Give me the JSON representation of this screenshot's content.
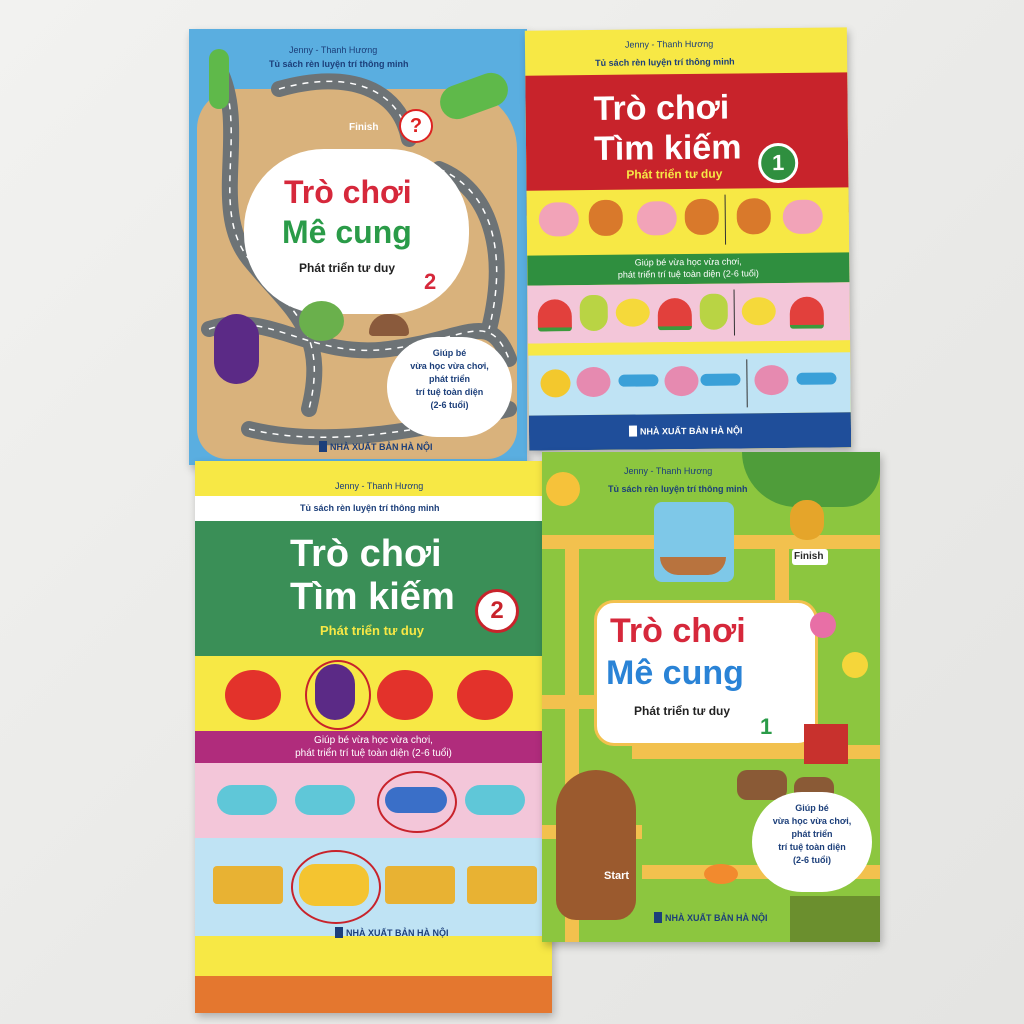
{
  "books": {
    "maze2": {
      "authors": "Jenny - Thanh Hương",
      "series": "Tủ sách rèn luyện trí thông minh",
      "finish": "Finish",
      "question": "?",
      "title_line1": "Trò chơi",
      "title_line2": "Mê cung",
      "subtitle": "Phát triển tư duy",
      "number": "2",
      "blurb": [
        "Giúp bé",
        "vừa học vừa chơi,",
        "phát triển",
        "trí tuệ toàn diện",
        "(2-6 tuổi)"
      ],
      "publisher": "NHÀ XUẤT BẢN HÀ NỘI"
    },
    "search1": {
      "authors": "Jenny - Thanh Hương",
      "series": "Tủ sách rèn luyện trí thông minh",
      "title_line1": "Trò chơi",
      "title_line2": "Tìm kiếm",
      "number": "1",
      "subtitle": "Phát triển tư duy",
      "blurb": [
        "Giúp bé vừa học vừa chơi,",
        "phát triển trí tuệ toàn diện (2-6 tuổi)"
      ],
      "publisher": "NHÀ XUẤT BẢN HÀ NỘI"
    },
    "search2": {
      "authors": "Jenny - Thanh Hương",
      "series": "Tủ sách rèn luyện trí thông minh",
      "title_line1": "Trò chơi",
      "title_line2": "Tìm kiếm",
      "number": "2",
      "subtitle": "Phát triển tư duy",
      "blurb": [
        "Giúp bé vừa học vừa chơi,",
        "phát triển trí tuệ toàn diện (2-6 tuổi)"
      ],
      "publisher": "NHÀ XUẤT BẢN HÀ NỘI"
    },
    "maze1": {
      "authors": "Jenny - Thanh Hương",
      "series": "Tủ sách rèn luyện trí thông minh",
      "finish": "Finish",
      "start": "Start",
      "title_line1": "Trò chơi",
      "title_line2": "Mê cung",
      "subtitle": "Phát triển tư duy",
      "number": "1",
      "blurb": [
        "Giúp bé",
        "vừa học vừa chơi,",
        "phát triển",
        "trí tuệ toàn diện",
        "(2-6 tuổi)"
      ],
      "publisher": "NHÀ XUẤT BẢN HÀ NỘI"
    }
  },
  "colors": {
    "maze_blue": "#5aaee0",
    "search1_red": "#c8232b",
    "search2_green": "#3a8f57",
    "yellow_band": "#f7e845",
    "pink_band": "#f3c6d9",
    "light_blue_band": "#bfe3f4",
    "maze1_grass": "#8cc63f"
  }
}
